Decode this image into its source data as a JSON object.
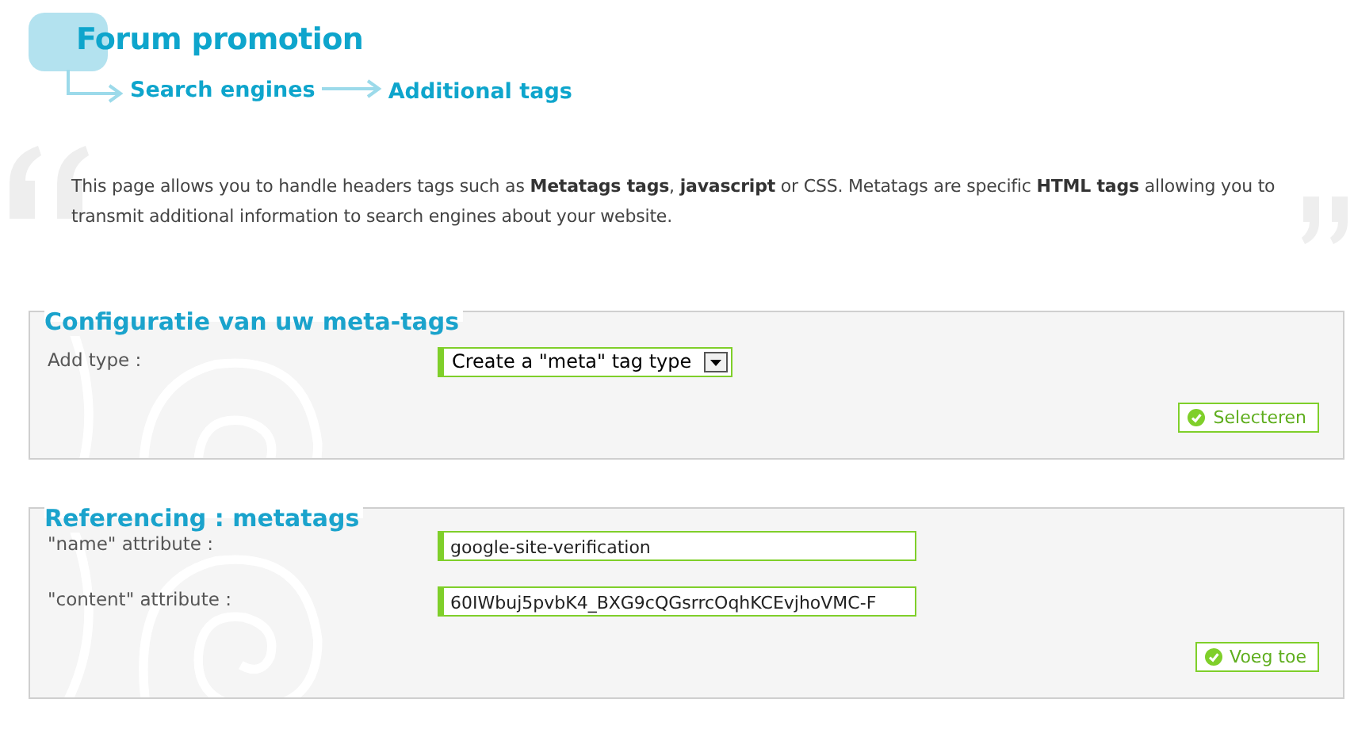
{
  "header": {
    "title": "Forum promotion",
    "breadcrumb": [
      "Search engines",
      "Additional tags"
    ]
  },
  "intro": "This page allows you to handle headers tags such as **Metatags tags**, **javascript** or CSS. Metatags are specific **HTML tags** allowing you to transmit additional information to search engines about your website.",
  "sections": [
    {
      "legend": "Configuratie van uw meta-tags",
      "fields": [
        {
          "kind": "select",
          "label": "Add type :",
          "value": "Create a \"meta\" tag type"
        }
      ],
      "button": "Selecteren"
    },
    {
      "legend": "Referencing : metatags",
      "fields": [
        {
          "kind": "text",
          "label": "\"name\" attribute :",
          "value": "google-site-verification"
        },
        {
          "kind": "text",
          "label": "\"content\" attribute :",
          "value": "60IWbuj5pvbK4_BXG9cQGsrrcOqhKCEvjhoVMC-F"
        }
      ],
      "button": "Voeg toe"
    }
  ]
}
